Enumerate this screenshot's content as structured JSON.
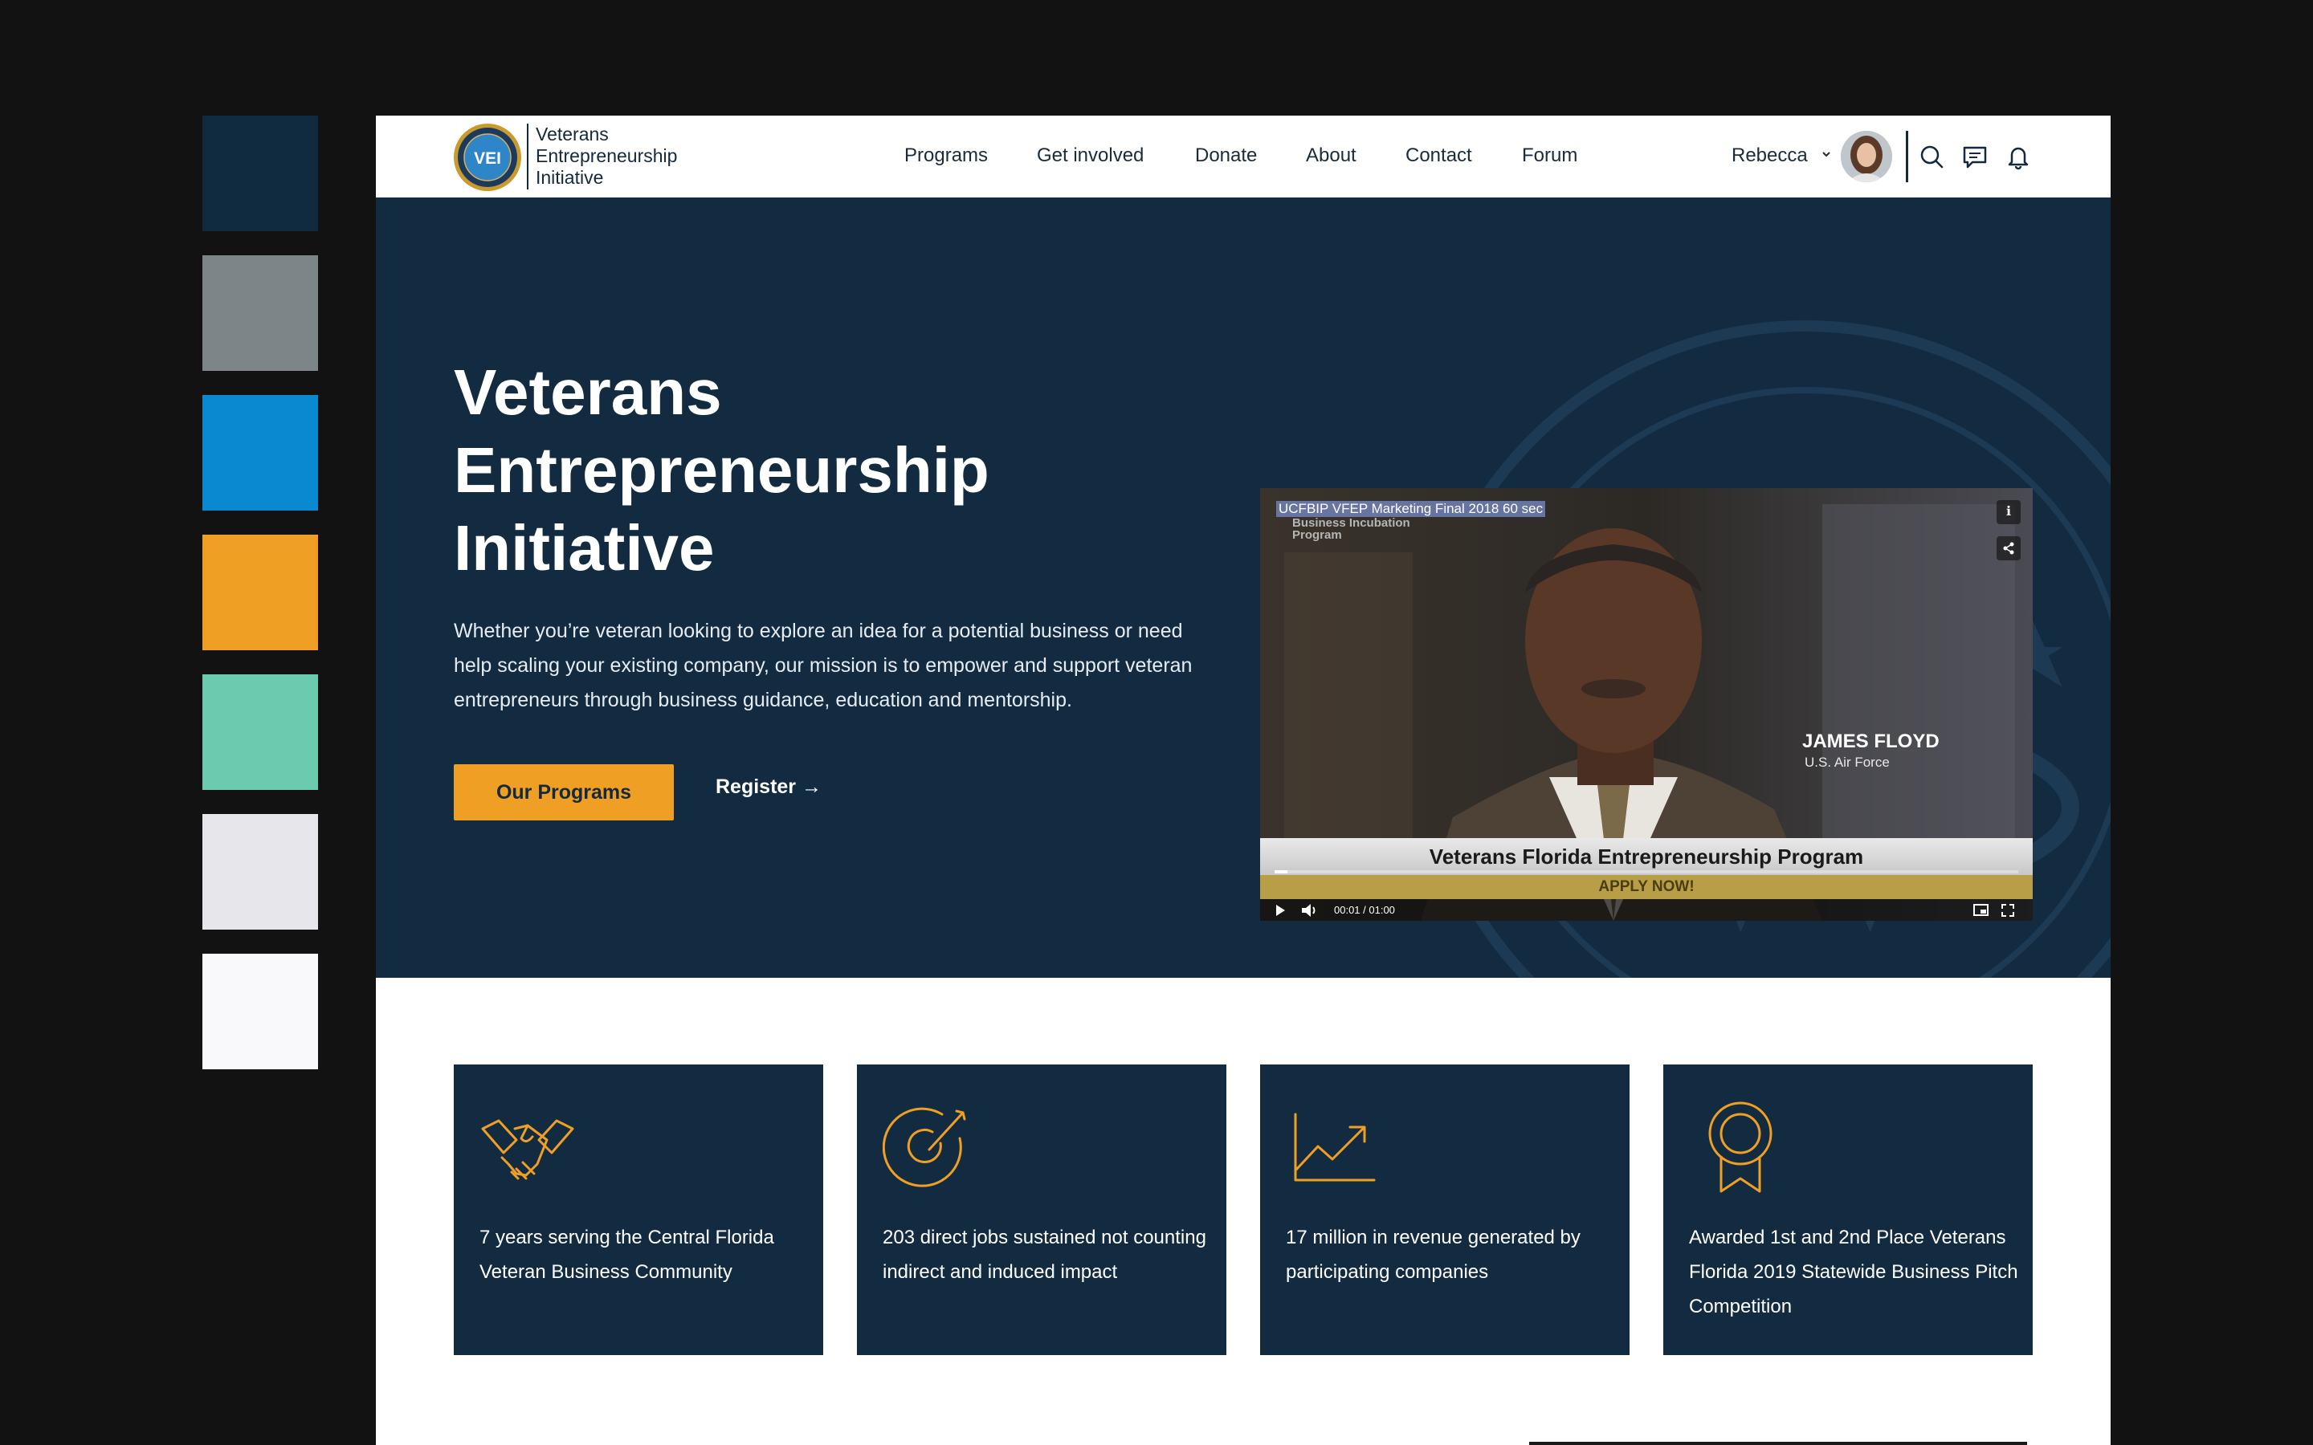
{
  "palette": {
    "swatches": [
      "#102a3f",
      "#7c8689",
      "#0a89d0",
      "#efa024",
      "#6ccbaf",
      "#e6e6eb",
      "#f9f9fc"
    ]
  },
  "header": {
    "logo_badge": "VEI",
    "logo_lines": [
      "Veterans",
      "Entrepreneurship",
      "Initiative"
    ],
    "nav": [
      "Programs",
      "Get involved",
      "Donate",
      "About",
      "Contact",
      "Forum"
    ],
    "user_name": "Rebecca",
    "icons": [
      "chevron-down-icon",
      "search-icon",
      "chat-icon",
      "bell-icon"
    ]
  },
  "hero": {
    "title_lines": [
      "Veterans",
      "Entrepreneurship",
      "Initiative"
    ],
    "description": "Whether you’re veteran looking to explore an idea for a potential business or need help scaling your existing company, our mission is to empower and support veteran entrepreneurs through business guidance, education and mentorship.",
    "primary_button": "Our Programs",
    "secondary_link": "Register →"
  },
  "video": {
    "title": "UCFBIP VFEP Marketing Final 2018 60 sec",
    "overlay_brand": [
      "Business Incubation",
      "Program"
    ],
    "speaker_name": "JAMES FLOYD",
    "speaker_role": "U.S. Air Force",
    "banner": "Veterans Florida Entrepreneurship Program",
    "cta": "APPLY NOW!",
    "time": "00:01 / 01:00",
    "progress": 0.017
  },
  "stats": [
    {
      "icon": "handshake-icon",
      "text": "7 years serving the Central Florida Veteran Business Community"
    },
    {
      "icon": "target-icon",
      "text": "203 direct jobs sustained not counting indirect and induced impact"
    },
    {
      "icon": "growth-chart-icon",
      "text": "17 million in revenue generated by participating companies"
    },
    {
      "icon": "award-ribbon-icon",
      "text": "Awarded 1st and 2nd Place Veterans Florida 2019 Statewide Business Pitch Competition"
    }
  ],
  "colors": {
    "navy": "#132b40",
    "accent": "#efa024",
    "frame": "#121212"
  }
}
